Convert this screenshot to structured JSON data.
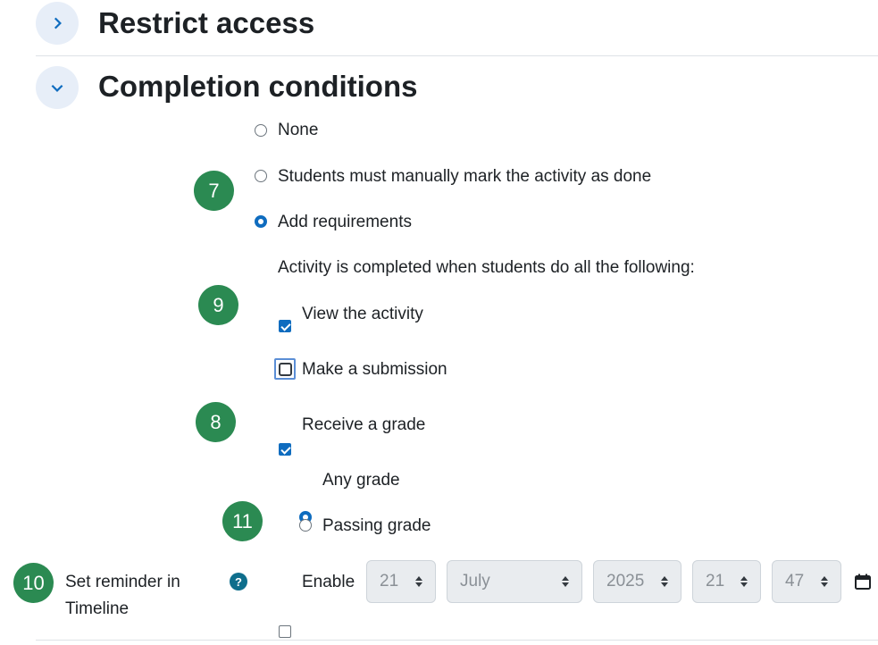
{
  "sections": {
    "restrict": {
      "title": "Restrict access",
      "state": "collapsed"
    },
    "completion": {
      "title": "Completion conditions",
      "state": "expanded"
    }
  },
  "completion_options": {
    "none": "None",
    "manual": "Students must manually mark the activity as done",
    "add_requirements": "Add requirements",
    "selected": "add_requirements"
  },
  "requirements": {
    "intro": "Activity is completed when students do all the following:",
    "view": {
      "label": "View the activity",
      "checked": true
    },
    "submission": {
      "label": "Make a submission",
      "checked": false
    },
    "grade": {
      "label": "Receive a grade",
      "checked": true
    },
    "any_grade": "Any grade",
    "passing_grade": "Passing grade",
    "grade_selected": "any_grade"
  },
  "badges": {
    "b7": "7",
    "b9": "9",
    "b8": "8",
    "b11": "11",
    "b10": "10"
  },
  "reminder": {
    "label": "Set reminder in Timeline",
    "help_icon": "?",
    "enable_label": "Enable",
    "enabled": false,
    "day": "21",
    "month": "July",
    "year": "2025",
    "hour": "21",
    "minute": "47",
    "calendar_icon": "calendar-icon"
  },
  "colors": {
    "accent": "#0f6cbf",
    "badge": "#2b8a52",
    "toggle_bg": "#e7eef8"
  }
}
